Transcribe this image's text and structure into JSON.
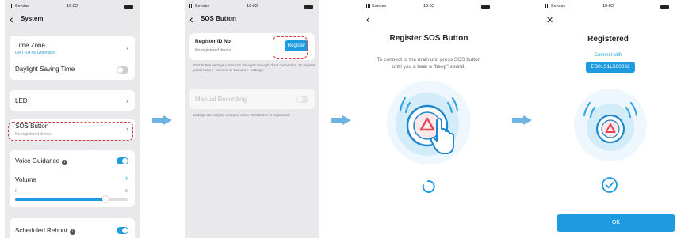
{
  "status_bar": {
    "carrier": "Service",
    "time": "19:02"
  },
  "screen1": {
    "title": "System",
    "time_zone_label": "Time Zone",
    "time_zone_value": "GMT+04:00 Greenland",
    "dst_label": "Daylight Saving Time",
    "led_label": "LED",
    "sos_label": "SOS Button",
    "sos_sub": "No registered device",
    "voice_label": "Voice Guidance",
    "volume_label": "Volume",
    "volume_value": "4",
    "volume_min": "0",
    "volume_max": "5",
    "volume_fraction": 0.8,
    "reboot_label": "Scheduled Reboot",
    "info_glyph": "i"
  },
  "screen2": {
    "title": "SOS Button",
    "reg_label": "Register ID No.",
    "reg_sub": "No registered device",
    "register_button": "Register",
    "note1": "SOS button settings cannot be changed through cloud connection. To register go to Home > Connect to Camera > Settings.",
    "manual_label": "Manual Recording",
    "note2": "Settings can only be changed when SOS button is registered."
  },
  "screen3": {
    "title": "Register SOS Button",
    "instruction": "To connect to the main unit press SOS button until you a hear a \"beep\" sound."
  },
  "screen4": {
    "title": "Registered",
    "connect_label": "Connect with",
    "device_id": "EB01S1L500002",
    "ok_button": "OK"
  },
  "colors": {
    "accent": "#1e9be0",
    "highlight": "#d04040",
    "arrow": "#6fb3e2",
    "alert": "#e0485a"
  },
  "icons": [
    "back-chevron-icon",
    "chevron-right-icon",
    "info-icon",
    "close-icon",
    "sos-button-icon",
    "hand-pointer-icon",
    "loading-spinner-icon",
    "check-circle-icon",
    "signal-icon",
    "battery-icon",
    "arrow-right-icon"
  ]
}
